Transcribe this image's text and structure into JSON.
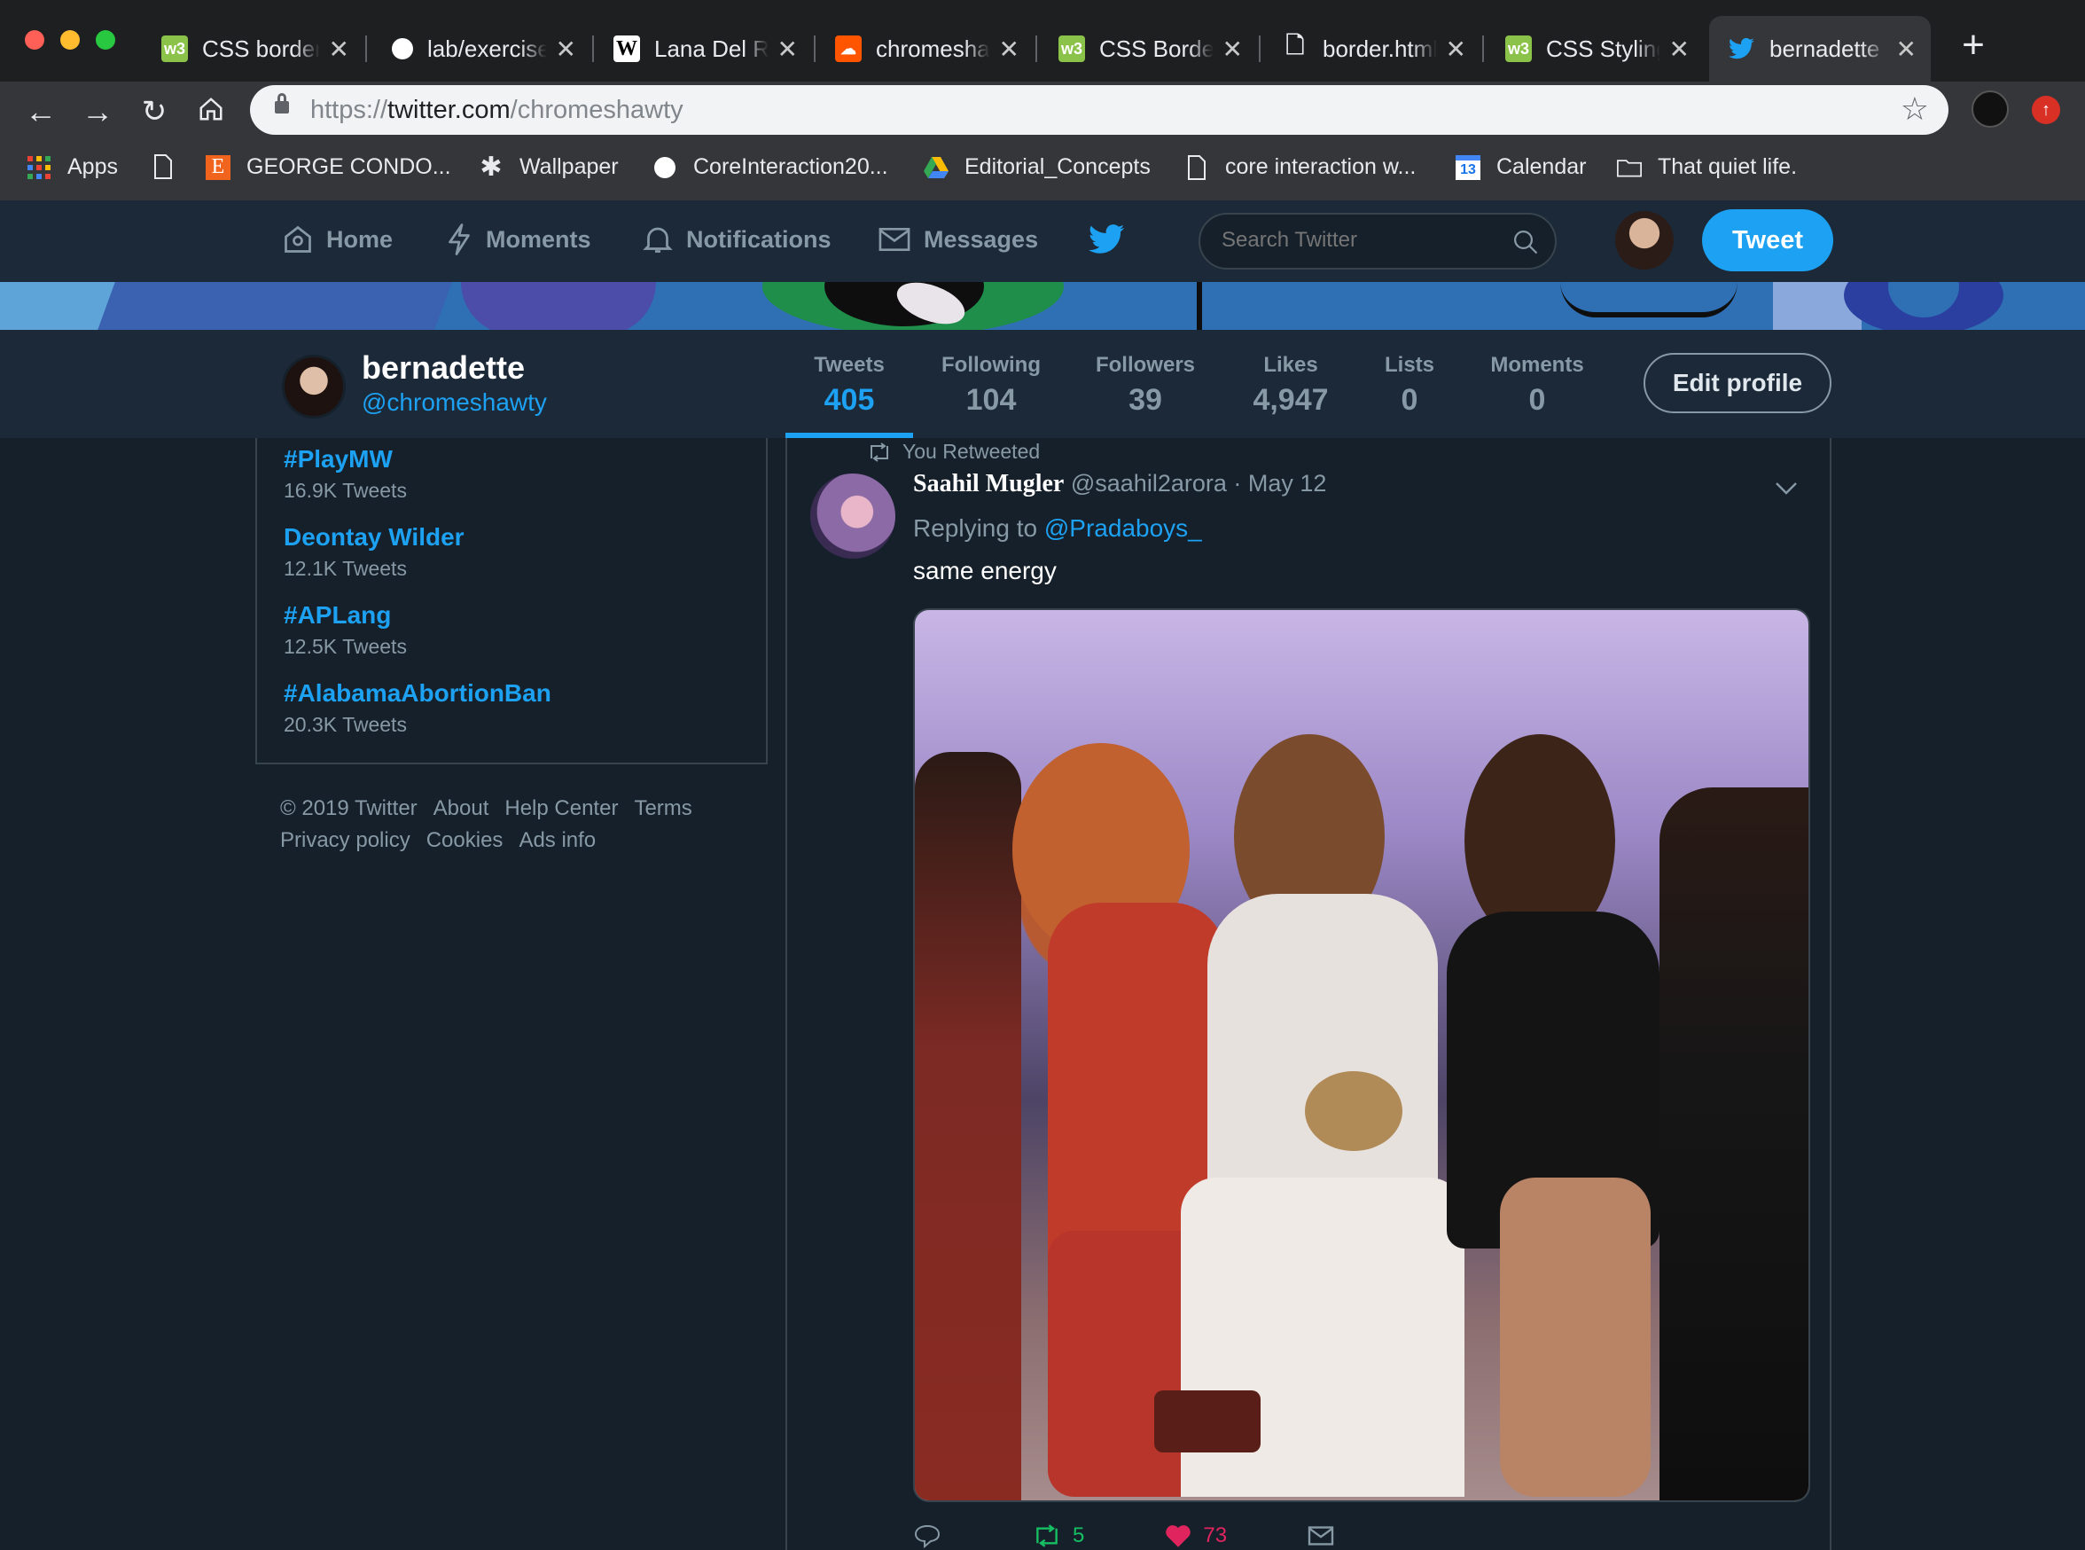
{
  "browser": {
    "tabs": [
      {
        "title": "CSS border",
        "favicon": "w3-icon",
        "fav_bg": "#8bc34a",
        "fav_text": "w3"
      },
      {
        "title": "lab/exercise",
        "favicon": "circle-icon",
        "fav_bg": "#ffffff",
        "fav_text": ""
      },
      {
        "title": "Lana Del Rey",
        "favicon": "wikipedia-icon",
        "fav_bg": "#ffffff",
        "fav_text": "W"
      },
      {
        "title": "chromeshawty",
        "favicon": "soundcloud-icon",
        "fav_bg": "#ff5500",
        "fav_text": "☁"
      },
      {
        "title": "CSS Border",
        "favicon": "w3-icon",
        "fav_bg": "#8bc34a",
        "fav_text": "w3"
      },
      {
        "title": "border.html",
        "favicon": "file-icon",
        "fav_bg": "transparent",
        "fav_text": "🗋"
      },
      {
        "title": "CSS Styling",
        "favicon": "w3-icon",
        "fav_bg": "#8bc34a",
        "fav_text": "w3"
      },
      {
        "title": "bernadette",
        "favicon": "twitter-icon",
        "fav_bg": "transparent",
        "fav_text": ""
      }
    ],
    "url_scheme": "https://",
    "url_host": "twitter.com",
    "url_path": "/chromeshawty",
    "bookmarks": [
      {
        "label": "Apps",
        "icon": "apps-grid-icon"
      },
      {
        "label": "",
        "icon": "file-icon"
      },
      {
        "label": "GEORGE CONDO...",
        "icon": "etsy-icon"
      },
      {
        "label": "Wallpaper",
        "icon": "star-badge-icon"
      },
      {
        "label": "CoreInteraction20...",
        "icon": "circle-icon"
      },
      {
        "label": "Editorial_Concepts",
        "icon": "drive-icon"
      },
      {
        "label": "core interaction w...",
        "icon": "file-icon"
      },
      {
        "label": "Calendar",
        "icon": "calendar-icon"
      },
      {
        "label": "That quiet life.",
        "icon": "folder-icon"
      }
    ],
    "calendar_day": "13"
  },
  "twitter": {
    "nav": {
      "home": "Home",
      "moments": "Moments",
      "notifications": "Notifications",
      "messages": "Messages",
      "search_placeholder": "Search Twitter",
      "tweet_button": "Tweet"
    },
    "profile": {
      "name": "bernadette",
      "handle": "@chromeshawty",
      "stats": [
        {
          "label": "Tweets",
          "value": "405",
          "active": true
        },
        {
          "label": "Following",
          "value": "104",
          "active": false
        },
        {
          "label": "Followers",
          "value": "39",
          "active": false
        },
        {
          "label": "Likes",
          "value": "4,947",
          "active": false
        },
        {
          "label": "Lists",
          "value": "0",
          "active": false
        },
        {
          "label": "Moments",
          "value": "0",
          "active": false
        }
      ],
      "edit_button": "Edit profile"
    },
    "trends": [
      {
        "name": "#PlayMW",
        "count": "16.9K Tweets"
      },
      {
        "name": "Deontay Wilder",
        "count": "12.1K Tweets"
      },
      {
        "name": "#APLang",
        "count": "12.5K Tweets"
      },
      {
        "name": "#AlabamaAbortionBan",
        "count": "20.3K Tweets"
      }
    ],
    "footer": [
      "© 2019 Twitter",
      "About",
      "Help Center",
      "Terms",
      "Privacy policy",
      "Cookies",
      "Ads info"
    ],
    "tweet": {
      "retweet_context": "You Retweeted",
      "author": "Saahil Mugler",
      "handle": "@saahil2arora",
      "separator": "·",
      "date": "May 12",
      "replying_prefix": "Replying to",
      "replying_to": "@Pradaboys_",
      "text": "same energy",
      "retweets": "5",
      "likes": "73"
    }
  },
  "colors": {
    "twitter_blue": "#1da1f2",
    "bg": "#15202b",
    "panel": "#1c2938",
    "muted": "#8899a6",
    "like_red": "#e0245e",
    "retweet_green": "#17bf63"
  }
}
